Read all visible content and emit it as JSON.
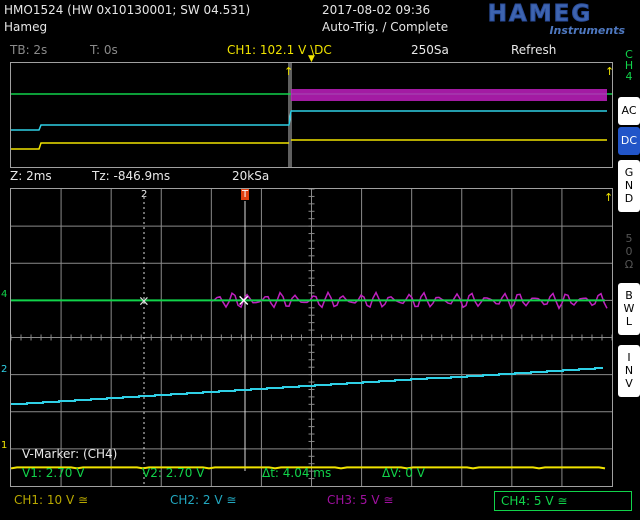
{
  "header": {
    "device": "HMO1524 (HW 0x10130001; SW 04.531)",
    "owner": "Hameg",
    "datetime": "2017-08-02 09:36",
    "trigger_state": "Auto-Trig. / Complete",
    "logo": "HAMEG",
    "logo_sub": "Instruments"
  },
  "overview_bar": {
    "timebase": "TB: 2s",
    "t_offset": "T: 0s",
    "trigger_info": "CH1: 102.1 V \\DC",
    "samples": "250Sa",
    "mode": "Refresh"
  },
  "zoom_bar": {
    "zoom": "Z: 2ms",
    "tz": "Tz: -846.9ms",
    "samples": "20kSa"
  },
  "right_menu": {
    "channel_tag": "CH4",
    "items": [
      {
        "label": "AC",
        "state": "normal"
      },
      {
        "label": "DC",
        "state": "selected"
      },
      {
        "label": "GND",
        "state": "normal"
      },
      {
        "label": "50Ω",
        "state": "disabled"
      },
      {
        "label": "BWL",
        "state": "normal"
      },
      {
        "label": "INV",
        "state": "normal"
      }
    ]
  },
  "markers": {
    "title": "V-Marker: (CH4)",
    "v1": "V1: 2.70 V",
    "v2": "V2: 2.70 V",
    "dt": "Δt: 4.04 ms",
    "dv": "ΔV: 0 V",
    "cursor1_label": "1",
    "cursor2_label": "2",
    "trigger_label": "T"
  },
  "channel_labels": {
    "ch1": "CH1: 10 V ≅",
    "ch2": "CH2: 2 V ≅",
    "ch3": "CH3: 5 V ≅",
    "ch4": "CH4: 5 V ≅"
  },
  "level_labels": {
    "ch4": "4",
    "ch2": "2",
    "ch1": "1"
  },
  "colors": {
    "ch1": "#f0e300",
    "ch2": "#2fd0e6",
    "ch3": "#c020c0",
    "ch4": "#11d34a",
    "grid": "#8a8a8a",
    "accent": "#2255c8"
  },
  "chart_data": {
    "type": "line",
    "grid": true,
    "x_divisions": 12,
    "y_divisions": 8,
    "series": [
      {
        "name": "CH1",
        "trace": "flat",
        "level_div": -3.5
      },
      {
        "name": "CH2",
        "trace": "ramp",
        "level_div_start": -1.8,
        "level_div_end": -0.8
      },
      {
        "name": "CH3",
        "trace": "noise",
        "level_div": 1.0
      },
      {
        "name": "CH4",
        "trace": "flat",
        "level_div": 1.0
      }
    ]
  }
}
